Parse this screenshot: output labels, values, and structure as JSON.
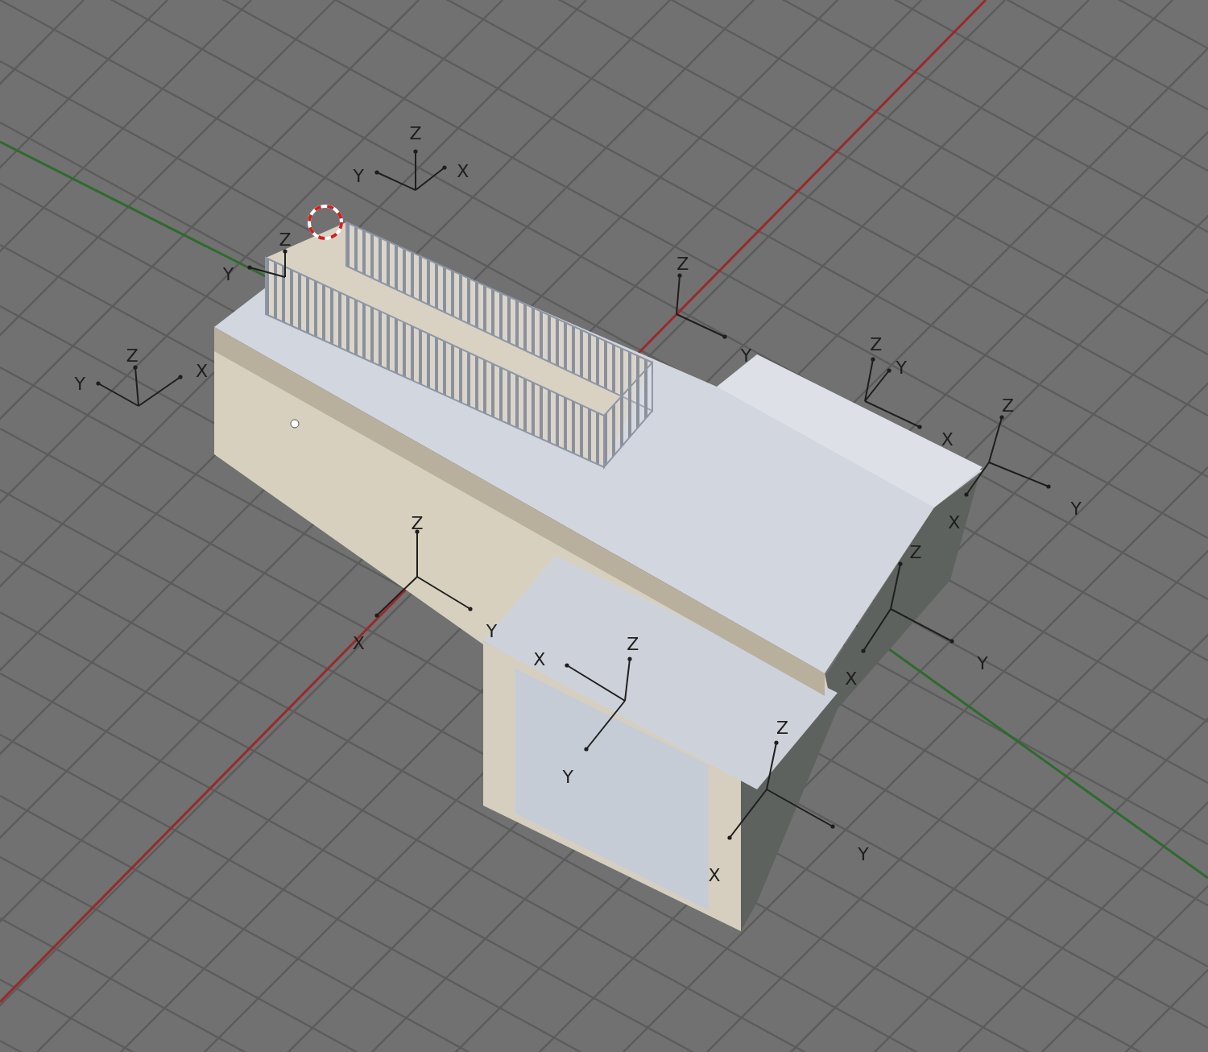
{
  "viewport": {
    "empties": [
      {
        "axes": [
          {
            "label": "Z"
          },
          {
            "label": "Y"
          },
          {
            "label": "X"
          }
        ]
      },
      {
        "axes": [
          {
            "label": "Z"
          },
          {
            "label": "Y"
          }
        ]
      },
      {
        "axes": [
          {
            "label": "Z"
          },
          {
            "label": "Y"
          },
          {
            "label": "X"
          }
        ]
      },
      {
        "axes": [
          {
            "label": "Z"
          },
          {
            "label": "Y"
          }
        ]
      },
      {
        "axes": [
          {
            "label": "Z"
          },
          {
            "label": "Y"
          },
          {
            "label": "X"
          }
        ]
      },
      {
        "axes": [
          {
            "label": "Z"
          },
          {
            "label": "Y"
          },
          {
            "label": "X"
          }
        ]
      },
      {
        "axes": [
          {
            "label": "Z"
          },
          {
            "label": "Y"
          },
          {
            "label": "X"
          }
        ]
      },
      {
        "axes": [
          {
            "label": "Z"
          },
          {
            "label": "Y"
          },
          {
            "label": "X"
          }
        ]
      },
      {
        "axes": [
          {
            "label": "Z"
          },
          {
            "label": "X"
          },
          {
            "label": "Y"
          }
        ]
      },
      {
        "axes": [
          {
            "label": "Z"
          },
          {
            "label": "Y"
          },
          {
            "label": "X"
          }
        ]
      }
    ]
  }
}
